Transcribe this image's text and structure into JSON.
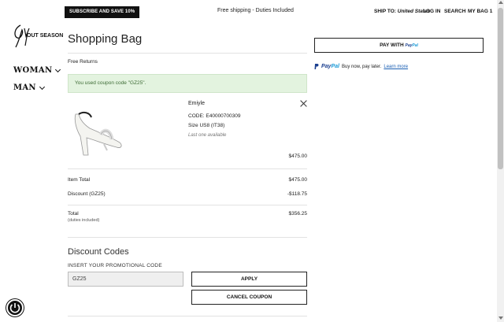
{
  "topbar": {
    "promo": "SUBSCRIBE AND SAVE 10%",
    "shipping": "Free shipping - Duties Included",
    "ship_to_label": "SHIP TO:",
    "ship_to_value": "United States",
    "login": "LOG IN",
    "search": "SEARCH",
    "bag": "MY BAG",
    "bag_count": "1"
  },
  "brand": {
    "logo_text": "OUT SEASON"
  },
  "nav": {
    "woman": "WOMAN",
    "man": "MAN"
  },
  "bag": {
    "title": "Shopping Bag",
    "free_returns": "Free Returns",
    "coupon_message": "You used coupon code \"GZ25\"."
  },
  "product": {
    "name": "Emiyle",
    "code": "CODE: E40000700309",
    "size": "Size US8 (IT38)",
    "availability": "Last one available",
    "price": "$475.00"
  },
  "summary": {
    "item_total_label": "Item Total",
    "item_total_value": "$475.00",
    "discount_label": "Discount (GZ25)",
    "discount_value": "-$118.75",
    "total_label": "Total",
    "total_note": "(duties included)",
    "total_value": "$356.25"
  },
  "discount": {
    "title": "Discount Codes",
    "input_label": "INSERT YOUR PROMOTIONAL CODE",
    "input_value": "GZ25",
    "apply": "APPLY",
    "cancel": "CANCEL COUPON"
  },
  "payment": {
    "pay_with": "PAY WITH",
    "paypal_brand_a": "Pay",
    "paypal_brand_b": "Pal",
    "paypal_text": "Buy now, pay later.",
    "learn_more": "Learn more"
  }
}
